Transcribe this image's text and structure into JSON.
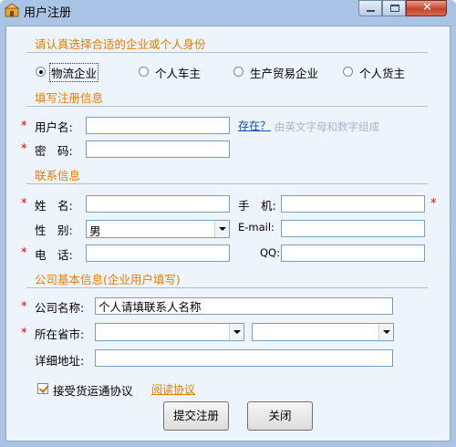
{
  "window": {
    "title": "用户注册"
  },
  "identity": {
    "heading": "请认真选择合适的企业或个人身份",
    "options": [
      {
        "label": "物流企业",
        "checked": true
      },
      {
        "label": "个人车主",
        "checked": false
      },
      {
        "label": "生产贸易企业",
        "checked": false
      },
      {
        "label": "个人货主",
        "checked": false
      }
    ]
  },
  "register": {
    "heading": "填写注册信息",
    "username_label": "用户名:",
    "username_value": "",
    "exists_link": "存在？",
    "username_hint": "由英文字母和数字组成",
    "password_label": "密　码:",
    "password_value": ""
  },
  "contact": {
    "heading": "联系信息",
    "name_label": "姓　名:",
    "name_value": "",
    "mobile_label": "手　机:",
    "mobile_value": "",
    "gender_label": "性　别:",
    "gender_value": "男",
    "email_label": "E-mail:",
    "email_value": "",
    "phone_label": "电　话:",
    "phone_value": "",
    "qq_label": "QQ:",
    "qq_value": ""
  },
  "company": {
    "heading": "公司基本信息(企业用户填写)",
    "name_label": "公司名称:",
    "name_value": "个人请填联系人名称",
    "region_label": "所在省市:",
    "province_value": "",
    "city_value": "",
    "address_label": "详细地址:",
    "address_value": ""
  },
  "agreement": {
    "checkbox_label": "接受货运通协议",
    "checked": true,
    "read_link": "阅读协议"
  },
  "actions": {
    "submit_label": "提交注册",
    "close_label": "关闭"
  },
  "required_mark": "*",
  "colors": {
    "section_heading": "#e67e00",
    "required": "#e00000",
    "link": "#0a4fb0",
    "window_frame": "#a9c4e4",
    "client_bg": "#eef4fb"
  }
}
